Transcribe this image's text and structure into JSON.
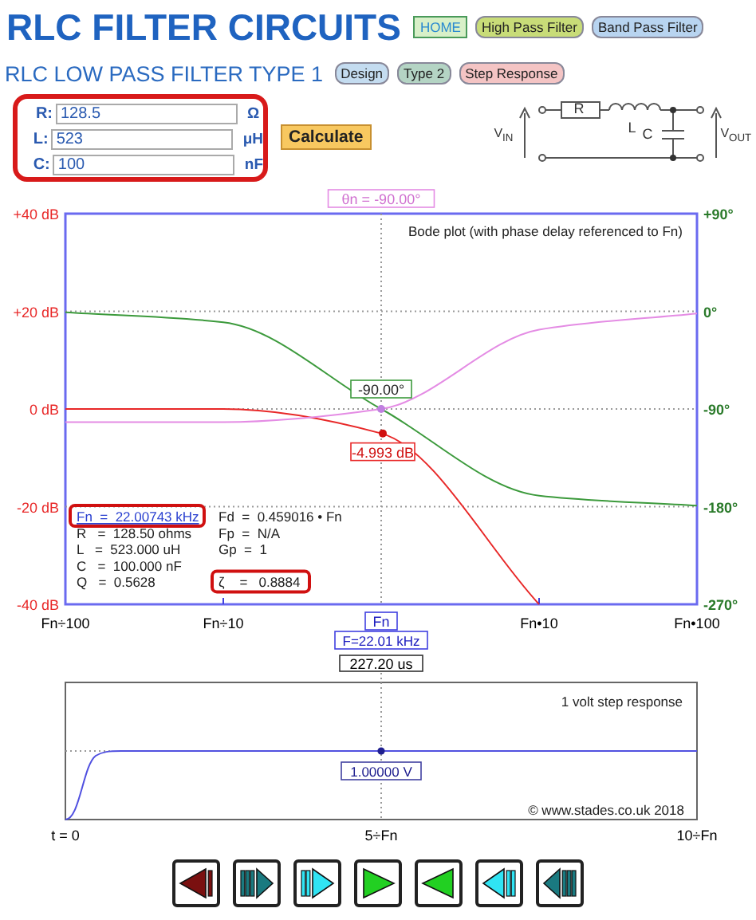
{
  "header": {
    "title": "RLC FILTER CIRCUITS",
    "links": [
      {
        "label": "HOME",
        "kind": "box",
        "color": "#d8f0c8"
      },
      {
        "label": "High Pass Filter",
        "kind": "pill",
        "color": "#c8dc78"
      },
      {
        "label": "Band Pass Filter",
        "kind": "pill",
        "color": "#b8d4f0"
      }
    ]
  },
  "subtitle": "RLC LOW PASS FILTER TYPE 1",
  "tabs": [
    {
      "label": "Design",
      "color": "#c4dcf0"
    },
    {
      "label": "Type 2",
      "color": "#b4d4c4"
    },
    {
      "label": "Step Response",
      "color": "#f4c4c4"
    }
  ],
  "inputs": {
    "highlighted": true,
    "fields": [
      {
        "label": "R:",
        "value": "128.5",
        "unit": "Ω"
      },
      {
        "label": "L:",
        "value": "523",
        "unit": "μH"
      },
      {
        "label": "C:",
        "value": "100",
        "unit": "nF"
      }
    ]
  },
  "calculate": "Calculate",
  "circuit": {
    "r": "R",
    "l": "L",
    "c": "C",
    "vin": "V$_{IN}$",
    "vout": "V$_{OUT}$"
  },
  "bode": {
    "cursor_phase_label": "θn = -90.00°",
    "phase_marker": "-90.00°",
    "gain_marker": "-4.993 dB",
    "frequency": "F=22.01 kHz",
    "info": [
      {
        "text": "Fn  =  22.00743 kHz",
        "highlighted": true,
        "link": true
      },
      {
        "text": "R   =  128.50 ohms",
        "highlighted": false,
        "link": false
      },
      {
        "text": "L   =  523.000 uH",
        "highlighted": false,
        "link": false
      },
      {
        "text": "C   =  100.000 nF",
        "highlighted": false,
        "link": false
      },
      {
        "text": "Q   =  0.5628",
        "highlighted": false,
        "link": false
      }
    ],
    "info_2": [
      {
        "text": "Fd  =  0.459016 • Fn",
        "highlighted": false
      },
      {
        "text": "Fp  =  N/A",
        "highlighted": false
      },
      {
        "text": "Gp  =  1",
        "highlighted": false
      },
      {
        "text": "ζ    =   0.8884",
        "highlighted": true
      }
    ],
    "chart_data": {
      "type": "line",
      "title": "Bode plot (with phase delay referenced to Fn)",
      "categories": [
        "Fn÷100",
        "Fn÷10",
        "Fn",
        "Fn•10",
        "Fn•100"
      ],
      "ylim": [
        -40,
        40
      ],
      "y2lim": [
        -270,
        90
      ],
      "grid": true,
      "yticks": [
        {
          "value": 40,
          "label": "+40 dB"
        },
        {
          "value": 20,
          "label": "+20 dB"
        },
        {
          "value": 0,
          "label": "0 dB"
        },
        {
          "value": -20,
          "label": "-20 dB"
        },
        {
          "value": -40,
          "label": "-40 dB"
        }
      ],
      "y2ticks": [
        {
          "value": 90,
          "label": "+90°"
        },
        {
          "value": 0,
          "label": "0°"
        },
        {
          "value": -90,
          "label": "-90°"
        },
        {
          "value": -180,
          "label": "-180°"
        },
        {
          "value": -270,
          "label": "-270°"
        }
      ],
      "series": [
        {
          "color": "#e82828",
          "values": [
            0,
            0,
            -5,
            -40,
            null
          ]
        },
        {
          "axis": "y2",
          "color": "#3c9a3c",
          "values": [
            -1,
            -10,
            -90,
            -170,
            -179
          ]
        },
        {
          "axis": "y2",
          "color": "#e48ce4",
          "values": [
            -102,
            -102,
            -90,
            -17,
            -2
          ]
        }
      ]
    }
  },
  "step": {
    "time": "227.20 us",
    "title": "1 volt step response",
    "value": "1.00000 V",
    "copyright": "© www.stades.co.uk 2018",
    "xticks": [
      "t = 0",
      "5÷Fn",
      "10÷Fn"
    ]
  },
  "controls": [
    {
      "kind": "first",
      "color": "#7a1010"
    },
    {
      "kind": "fast-forward",
      "color": "#1a7a80"
    },
    {
      "kind": "forward",
      "color": "#30e4f4"
    },
    {
      "kind": "play",
      "color": "#22d022"
    },
    {
      "kind": "back",
      "color": "#22d022"
    },
    {
      "kind": "reverse",
      "color": "#30e4f4"
    },
    {
      "kind": "fast-reverse",
      "color": "#1a7a80"
    }
  ]
}
